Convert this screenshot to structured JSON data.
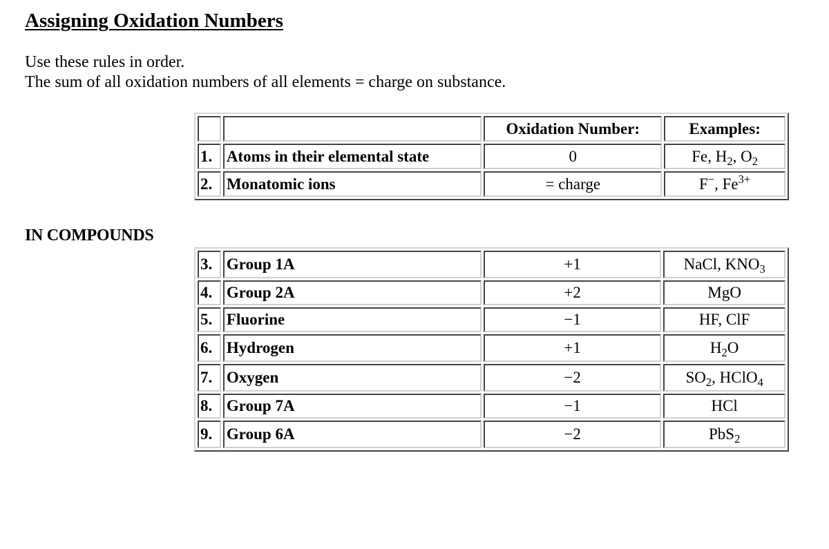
{
  "page": {
    "title": "Assigning Oxidation Numbers",
    "intro_lines": [
      "Use these rules in order.",
      "The sum of all oxidation numbers of all elements = charge on substance."
    ],
    "section_heading": "IN COMPOUNDS"
  },
  "table_basic": {
    "headers": {
      "number": "",
      "rule": "",
      "oxidation_number": "Oxidation Number:",
      "examples": "Examples:"
    },
    "rows": [
      {
        "number": "1.",
        "rule": "Atoms in their elemental state",
        "oxidation_number": "0",
        "examples": [
          {
            "text": "Fe, H"
          },
          {
            "sub": "2"
          },
          {
            "text": ", O"
          },
          {
            "sub": "2"
          }
        ]
      },
      {
        "number": "2.",
        "rule": "Monatomic ions",
        "oxidation_number": "= charge",
        "examples": [
          {
            "text": "F"
          },
          {
            "sup": "−"
          },
          {
            "text": ", Fe"
          },
          {
            "sup": "3+"
          }
        ]
      }
    ]
  },
  "table_compounds": {
    "rows": [
      {
        "number": "3.",
        "rule": "Group 1A",
        "oxidation_number": "+1",
        "examples": [
          {
            "text": "NaCl, KNO"
          },
          {
            "sub": "3"
          }
        ]
      },
      {
        "number": "4.",
        "rule": "Group 2A",
        "oxidation_number": "+2",
        "examples": [
          {
            "text": "MgO"
          }
        ]
      },
      {
        "number": "5.",
        "rule": "Fluorine",
        "oxidation_number": "−1",
        "examples": [
          {
            "text": "HF, ClF"
          }
        ]
      },
      {
        "number": "6.",
        "rule": "Hydrogen",
        "oxidation_number": "+1",
        "examples": [
          {
            "text": "H"
          },
          {
            "sub": "2"
          },
          {
            "text": "O"
          }
        ]
      },
      {
        "number": "7.",
        "rule": "Oxygen",
        "oxidation_number": "−2",
        "examples": [
          {
            "text": "SO"
          },
          {
            "sub": "2"
          },
          {
            "text": ", HClO"
          },
          {
            "sub": "4"
          }
        ]
      },
      {
        "number": "8.",
        "rule": "Group 7A",
        "oxidation_number": "−1",
        "examples": [
          {
            "text": "HCl"
          }
        ]
      },
      {
        "number": "9.",
        "rule": "Group 6A",
        "oxidation_number": "−2",
        "examples": [
          {
            "text": "PbS"
          },
          {
            "sub": "2"
          }
        ]
      }
    ]
  }
}
